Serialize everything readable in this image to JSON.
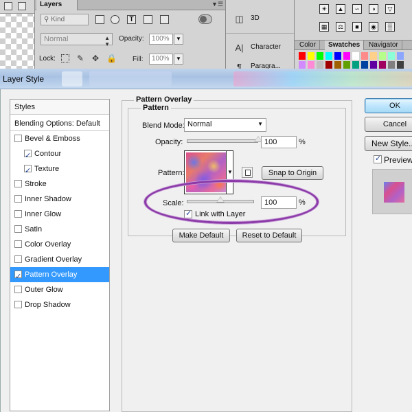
{
  "background_app": {
    "layers_panel": {
      "tab_label": "Layers",
      "menu_icon": "panel-menu-icon",
      "kind_filter": "Kind",
      "blend_mode": "Normal",
      "opacity_label": "Opacity:",
      "opacity_value": "100%",
      "lock_label": "Lock:",
      "fill_label": "Fill:",
      "fill_value": "100%"
    },
    "mid_panel": {
      "items": [
        {
          "label": "3D",
          "icon": "cube-icon"
        },
        {
          "label": "Character",
          "icon": "character-icon"
        },
        {
          "label": "Paragra...",
          "icon": "paragraph-icon"
        }
      ]
    },
    "right_panel": {
      "tabs": [
        "Color",
        "Swatches",
        "Navigator"
      ],
      "active_tab": "Swatches",
      "swatch_colors": [
        "#ff0000",
        "#ffff00",
        "#00ff00",
        "#00ffff",
        "#0000ff",
        "#ff00ff",
        "#ffffff",
        "#ff8a8a",
        "#ffd08a",
        "#b6ff8a",
        "#8affd8",
        "#8aa6ff",
        "#d28aff",
        "#ff8ad6",
        "#c0c0c0",
        "#a00000",
        "#a06000",
        "#60a000",
        "#00a080",
        "#0040a0",
        "#6000a0",
        "#a00060",
        "#808080",
        "#404040"
      ]
    }
  },
  "dialog": {
    "title": "Layer Style",
    "styles_list": {
      "header": "Styles",
      "blending_options": "Blending Options: Default",
      "items": [
        {
          "label": "Bevel & Emboss",
          "checked": false,
          "indent": false,
          "selected": false
        },
        {
          "label": "Contour",
          "checked": true,
          "indent": true,
          "selected": false
        },
        {
          "label": "Texture",
          "checked": true,
          "indent": true,
          "selected": false
        },
        {
          "label": "Stroke",
          "checked": false,
          "indent": false,
          "selected": false
        },
        {
          "label": "Inner Shadow",
          "checked": false,
          "indent": false,
          "selected": false
        },
        {
          "label": "Inner Glow",
          "checked": false,
          "indent": false,
          "selected": false
        },
        {
          "label": "Satin",
          "checked": false,
          "indent": false,
          "selected": false
        },
        {
          "label": "Color Overlay",
          "checked": false,
          "indent": false,
          "selected": false
        },
        {
          "label": "Gradient Overlay",
          "checked": false,
          "indent": false,
          "selected": false
        },
        {
          "label": "Pattern Overlay",
          "checked": true,
          "indent": false,
          "selected": true
        },
        {
          "label": "Outer Glow",
          "checked": false,
          "indent": false,
          "selected": false
        },
        {
          "label": "Drop Shadow",
          "checked": false,
          "indent": false,
          "selected": false
        }
      ]
    },
    "pattern_overlay": {
      "group_title": "Pattern Overlay",
      "subgroup_title": "Pattern",
      "blend_mode_label": "Blend Mode:",
      "blend_mode_value": "Normal",
      "opacity_label": "Opacity:",
      "opacity_value": "100",
      "opacity_level": 100,
      "percent_sign": "%",
      "pattern_label": "Pattern:",
      "snap_to_origin": "Snap to Origin",
      "scale_label": "Scale:",
      "scale_value": "100",
      "scale_level": 50,
      "link_with_layer_label": "Link with Layer",
      "link_with_layer_checked": true,
      "make_default": "Make Default",
      "reset_to_default": "Reset to Default"
    },
    "buttons": {
      "ok": "OK",
      "cancel": "Cancel",
      "new_style": "New Style...",
      "preview_label": "Preview",
      "preview_checked": true
    },
    "highlight_color": "#8b3aa8",
    "selection_color": "#3399ff"
  }
}
